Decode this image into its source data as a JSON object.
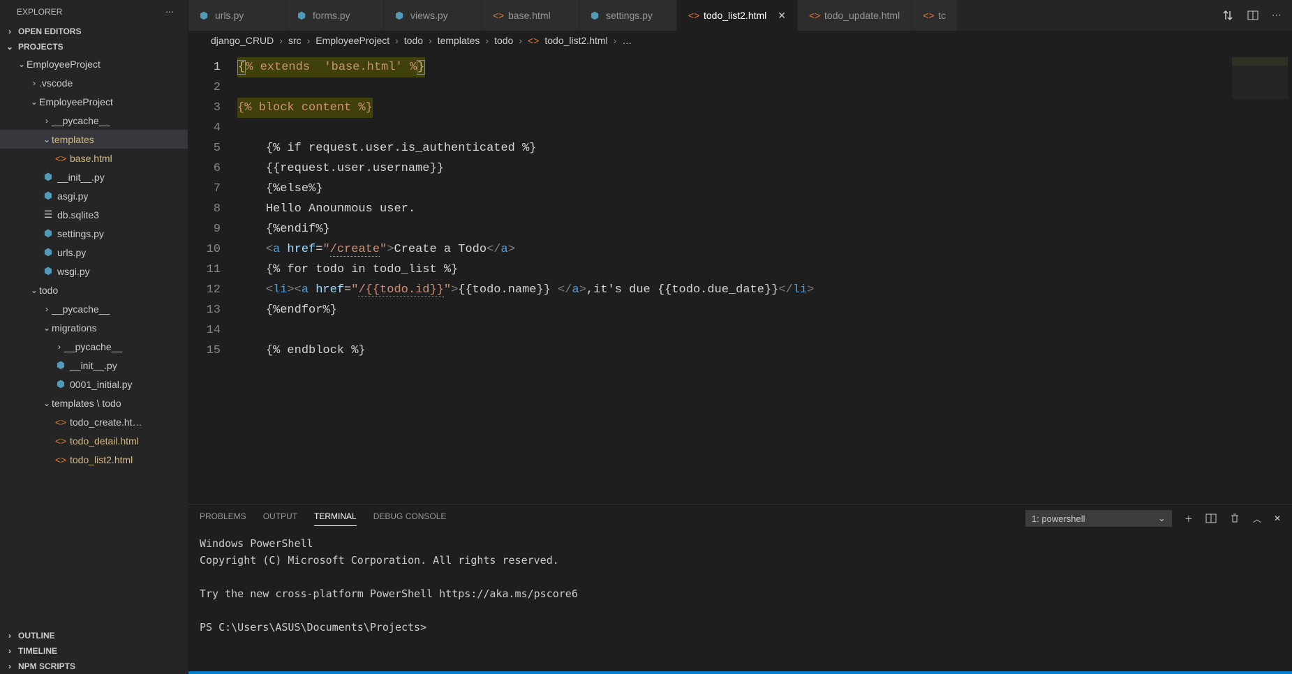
{
  "sidebar": {
    "title": "EXPLORER",
    "sections": {
      "open_editors": "OPEN EDITORS",
      "projects": "PROJECTS",
      "outline": "OUTLINE",
      "timeline": "TIMELINE",
      "npm_scripts": "NPM SCRIPTS"
    },
    "tree": [
      {
        "label": "EmployeeProject",
        "indent": 0,
        "kind": "folder-open"
      },
      {
        "label": ".vscode",
        "indent": 1,
        "kind": "folder-closed"
      },
      {
        "label": "EmployeeProject",
        "indent": 1,
        "kind": "folder-open"
      },
      {
        "label": "__pycache__",
        "indent": 2,
        "kind": "folder-closed"
      },
      {
        "label": "templates",
        "indent": 2,
        "kind": "folder-open",
        "mod": true,
        "sel": true
      },
      {
        "label": "base.html",
        "indent": 3,
        "kind": "html",
        "mod": true
      },
      {
        "label": "__init__.py",
        "indent": 2,
        "kind": "py"
      },
      {
        "label": "asgi.py",
        "indent": 2,
        "kind": "py"
      },
      {
        "label": "db.sqlite3",
        "indent": 2,
        "kind": "db"
      },
      {
        "label": "settings.py",
        "indent": 2,
        "kind": "py"
      },
      {
        "label": "urls.py",
        "indent": 2,
        "kind": "py"
      },
      {
        "label": "wsgi.py",
        "indent": 2,
        "kind": "py"
      },
      {
        "label": "todo",
        "indent": 1,
        "kind": "folder-open"
      },
      {
        "label": "__pycache__",
        "indent": 2,
        "kind": "folder-closed"
      },
      {
        "label": "migrations",
        "indent": 2,
        "kind": "folder-open"
      },
      {
        "label": "__pycache__",
        "indent": 3,
        "kind": "folder-closed"
      },
      {
        "label": "__init__.py",
        "indent": 3,
        "kind": "py"
      },
      {
        "label": "0001_initial.py",
        "indent": 3,
        "kind": "py"
      },
      {
        "label": "templates \\ todo",
        "indent": 2,
        "kind": "folder-open"
      },
      {
        "label": "todo_create.ht…",
        "indent": 3,
        "kind": "html"
      },
      {
        "label": "todo_detail.html",
        "indent": 3,
        "kind": "html",
        "mod": true
      },
      {
        "label": "todo_list2.html",
        "indent": 3,
        "kind": "html",
        "mod": true
      }
    ]
  },
  "tabs": [
    {
      "label": "urls.py",
      "icon": "py"
    },
    {
      "label": "forms.py",
      "icon": "py"
    },
    {
      "label": "views.py",
      "icon": "py"
    },
    {
      "label": "base.html",
      "icon": "html"
    },
    {
      "label": "settings.py",
      "icon": "py"
    },
    {
      "label": "todo_list2.html",
      "icon": "html",
      "active": true
    },
    {
      "label": "todo_update.html",
      "icon": "html"
    },
    {
      "label": "tc",
      "icon": "html",
      "trunc": true
    }
  ],
  "breadcrumbs": [
    "django_CRUD",
    "src",
    "EmployeeProject",
    "todo",
    "templates",
    "todo",
    "todo_list2.html",
    "…"
  ],
  "code_lines": [
    {
      "n": 1,
      "segs": [
        {
          "t": "{",
          "c": "yellow",
          "hl": true,
          "boxed": true
        },
        {
          "t": "% extends  'base.html' %",
          "c": "orange",
          "hl": true
        },
        {
          "t": "}",
          "c": "yellow",
          "hl": true,
          "boxed": true
        }
      ]
    },
    {
      "n": 2,
      "segs": []
    },
    {
      "n": 3,
      "segs": [
        {
          "t": "{% block content %}",
          "c": "orange",
          "hl": true
        }
      ]
    },
    {
      "n": 4,
      "segs": []
    },
    {
      "n": 5,
      "segs": [
        {
          "t": "    ",
          "c": "white"
        },
        {
          "t": "{% if request.user.is_authenticated %}",
          "c": "white"
        }
      ]
    },
    {
      "n": 6,
      "segs": [
        {
          "t": "    ",
          "c": "white"
        },
        {
          "t": "{{request.user.username}}",
          "c": "white"
        }
      ]
    },
    {
      "n": 7,
      "segs": [
        {
          "t": "    ",
          "c": "white"
        },
        {
          "t": "{%else%}",
          "c": "white"
        }
      ]
    },
    {
      "n": 8,
      "segs": [
        {
          "t": "    ",
          "c": "white"
        },
        {
          "t": "Hello Anounmous user.",
          "c": "white"
        }
      ]
    },
    {
      "n": 9,
      "segs": [
        {
          "t": "    ",
          "c": "white"
        },
        {
          "t": "{%endif%}",
          "c": "white"
        }
      ]
    },
    {
      "n": 10,
      "segs": [
        {
          "t": "    ",
          "c": "white"
        },
        {
          "t": "<",
          "c": "grey"
        },
        {
          "t": "a",
          "c": "blue"
        },
        {
          "t": " ",
          "c": "white"
        },
        {
          "t": "href",
          "c": "lightblue"
        },
        {
          "t": "=",
          "c": "white"
        },
        {
          "t": "\"",
          "c": "orange"
        },
        {
          "t": "/create",
          "c": "orange",
          "err": true
        },
        {
          "t": "\"",
          "c": "orange"
        },
        {
          "t": ">",
          "c": "grey"
        },
        {
          "t": "Create a Todo",
          "c": "white"
        },
        {
          "t": "</",
          "c": "grey"
        },
        {
          "t": "a",
          "c": "blue"
        },
        {
          "t": ">",
          "c": "grey"
        }
      ]
    },
    {
      "n": 11,
      "segs": [
        {
          "t": "    ",
          "c": "white"
        },
        {
          "t": "{% for todo in todo_list %}",
          "c": "white"
        }
      ]
    },
    {
      "n": 12,
      "segs": [
        {
          "t": "    ",
          "c": "white"
        },
        {
          "t": "<",
          "c": "grey"
        },
        {
          "t": "li",
          "c": "blue"
        },
        {
          "t": "><",
          "c": "grey"
        },
        {
          "t": "a",
          "c": "blue"
        },
        {
          "t": " ",
          "c": "white"
        },
        {
          "t": "href",
          "c": "lightblue"
        },
        {
          "t": "=",
          "c": "white"
        },
        {
          "t": "\"",
          "c": "orange"
        },
        {
          "t": "/{{todo.id}}",
          "c": "orange",
          "err": true
        },
        {
          "t": "\"",
          "c": "orange"
        },
        {
          "t": ">",
          "c": "grey"
        },
        {
          "t": "{{todo.name}} ",
          "c": "white"
        },
        {
          "t": "</",
          "c": "grey"
        },
        {
          "t": "a",
          "c": "blue"
        },
        {
          "t": ">",
          "c": "grey"
        },
        {
          "t": ",it's due {{todo.due_date}}",
          "c": "white"
        },
        {
          "t": "</",
          "c": "grey"
        },
        {
          "t": "li",
          "c": "blue"
        },
        {
          "t": ">",
          "c": "grey"
        }
      ]
    },
    {
      "n": 13,
      "segs": [
        {
          "t": "    ",
          "c": "white"
        },
        {
          "t": "{%endfor%}",
          "c": "white"
        }
      ]
    },
    {
      "n": 14,
      "segs": []
    },
    {
      "n": 15,
      "segs": [
        {
          "t": "    ",
          "c": "white"
        },
        {
          "t": "{% endblock %}",
          "c": "white"
        }
      ]
    }
  ],
  "panel": {
    "tabs": {
      "problems": "PROBLEMS",
      "output": "OUTPUT",
      "terminal": "TERMINAL",
      "debug": "DEBUG CONSOLE"
    },
    "shell_select": "1: powershell",
    "terminal_lines": [
      "Windows PowerShell",
      "Copyright (C) Microsoft Corporation. All rights reserved.",
      "",
      "Try the new cross-platform PowerShell https://aka.ms/pscore6",
      "",
      "PS C:\\Users\\ASUS\\Documents\\Projects>"
    ]
  }
}
